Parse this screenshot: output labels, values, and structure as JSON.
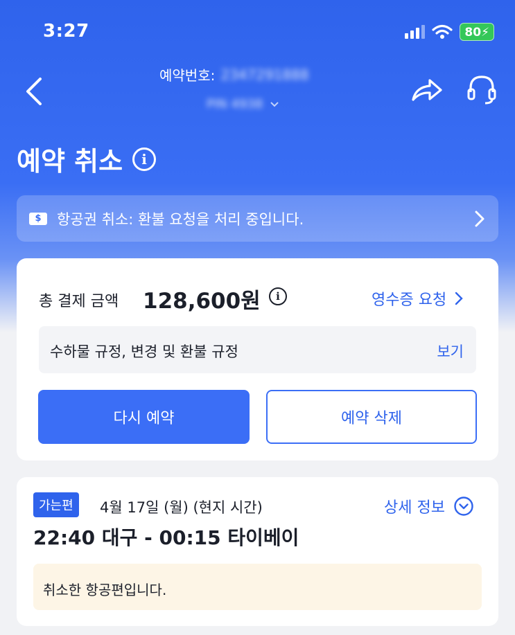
{
  "status_bar": {
    "time": "3:27",
    "battery": "80"
  },
  "header": {
    "booking_label": "예약번호:",
    "booking_number": "2347291888",
    "pin": "PIN 4938"
  },
  "title": "예약 취소",
  "notice": {
    "text": "항공권 취소: 환불 요청을 처리 중입니다."
  },
  "payment": {
    "total_label": "총 결제 금액",
    "total_amount": "128,600원",
    "receipt_link": "영수증 요청",
    "rules_text": "수하물 규정, 변경 및 환불 규정",
    "rules_view": "보기",
    "rebook_button": "다시 예약",
    "delete_button": "예약 삭제"
  },
  "flight": {
    "direction_badge": "가는편",
    "date": "4월 17일 (월) (현지 시간)",
    "details_link": "상세 정보",
    "route": "22:40 대구 - 00:15 타이베이",
    "cancel_note": "취소한 항공편입니다."
  },
  "colors": {
    "brand_blue": "#2f63ec",
    "button_blue": "#3b6ef6",
    "battery_green": "#34c759",
    "notice_bg": "#fdf5e6"
  }
}
